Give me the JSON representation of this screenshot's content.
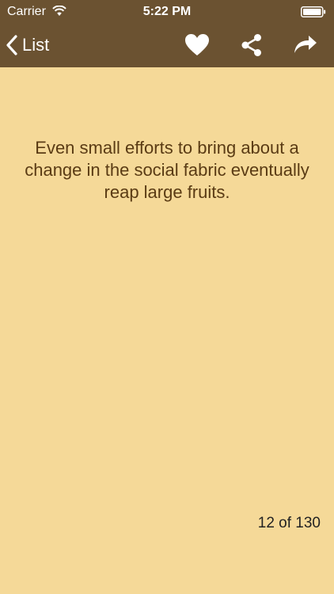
{
  "status_bar": {
    "carrier": "Carrier",
    "time": "5:22 PM"
  },
  "nav": {
    "back_label": "List",
    "icons": [
      "favorite-heart-icon",
      "share-icon",
      "forward-icon"
    ]
  },
  "quote": {
    "text": "Even small efforts to bring about a change in the social fabric eventually reap large fruits."
  },
  "pagination": {
    "counter": "12 of 130"
  },
  "colors": {
    "nav_background": "#6b5231",
    "page_background": "#f5d998",
    "quote_text": "#5a3b14"
  }
}
